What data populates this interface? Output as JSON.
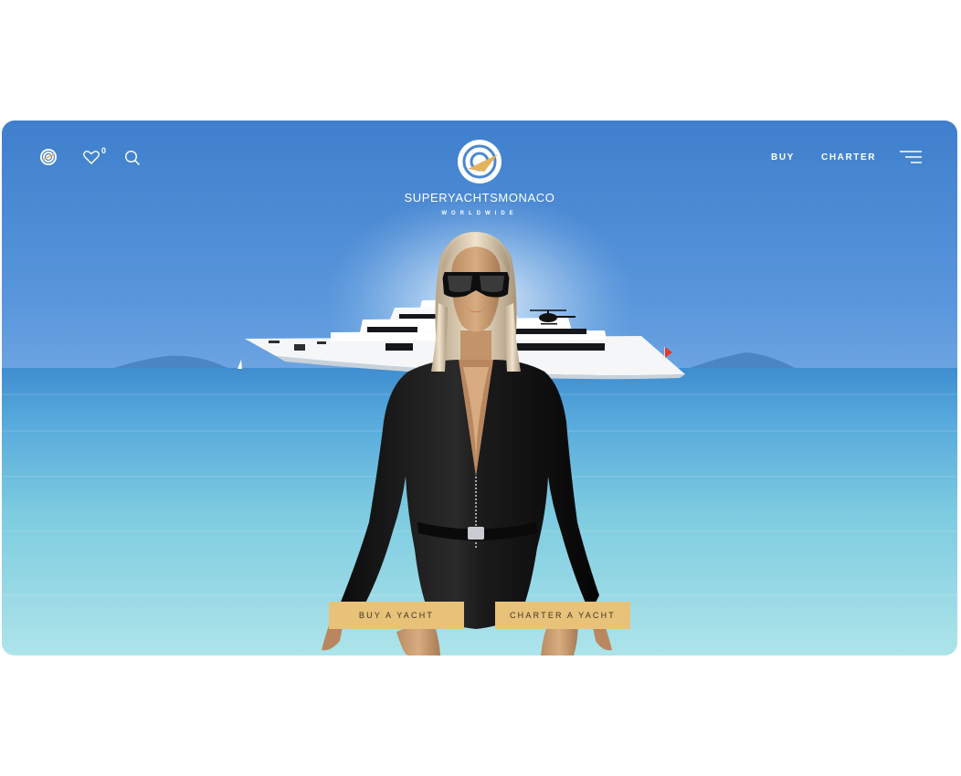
{
  "header": {
    "favorites_count": "0",
    "nav": {
      "buy_label": "BUY",
      "charter_label": "CHARTER"
    },
    "icons": {
      "language": "globe-icon",
      "favorites": "heart-icon",
      "search": "search-icon",
      "menu": "hamburger-menu-icon"
    }
  },
  "brand": {
    "name": "SUPERYACHTSMONACO",
    "tagline": "WORLDWIDE"
  },
  "hero": {
    "buttons": {
      "buy_label": "BUY A YACHT",
      "charter_label": "CHARTER A YACHT"
    }
  },
  "colors": {
    "sky_top": "#3f7fcc",
    "sea_horizon": "#3a8fd0",
    "sea_shore": "#a9e0ea",
    "cta_background": "#e8c279",
    "cta_text": "#3d3426",
    "header_text": "#ffffff"
  }
}
